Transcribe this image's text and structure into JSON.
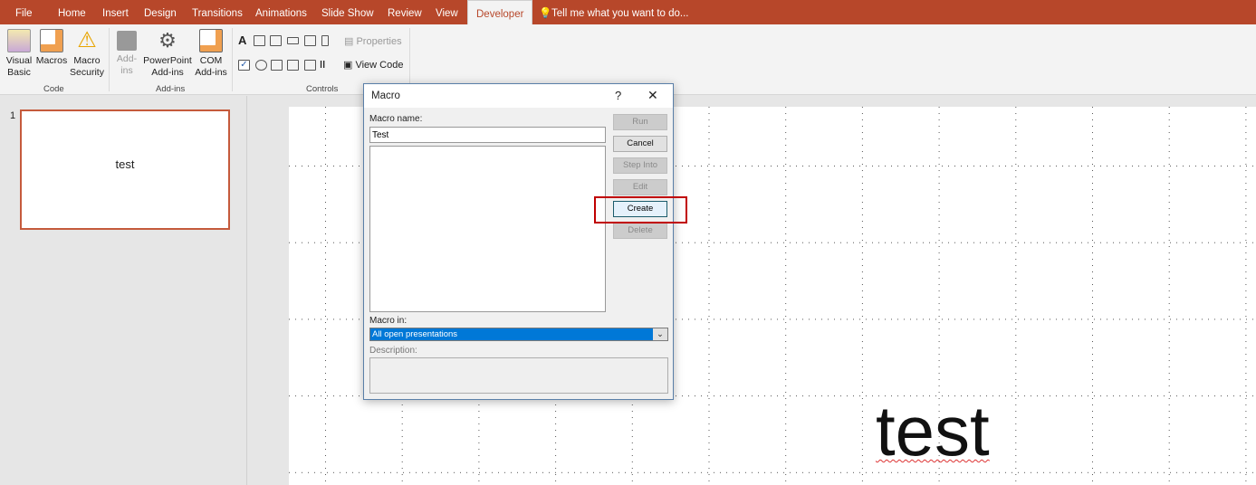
{
  "tabs": [
    "File",
    "Home",
    "Insert",
    "Design",
    "Transitions",
    "Animations",
    "Slide Show",
    "Review",
    "View",
    "Developer"
  ],
  "tell_me": "Tell me what you want to do...",
  "ribbon": {
    "visual_basic": [
      "Visual",
      "Basic"
    ],
    "macros": "Macros",
    "macro_security": [
      "Macro",
      "Security"
    ],
    "addins": [
      "Add-",
      "ins"
    ],
    "ppt_addins": [
      "PowerPoint",
      "Add-ins"
    ],
    "com_addins": [
      "COM",
      "Add-ins"
    ],
    "properties": "Properties",
    "view_code": "View Code",
    "control_a": "A",
    "groups": {
      "code": "Code",
      "addins": "Add-ins",
      "controls": "Controls"
    }
  },
  "slides": {
    "number": "1",
    "thumb_text": "test"
  },
  "slide_text": "test",
  "dialog": {
    "title": "Macro",
    "help": "?",
    "close": "✕",
    "macro_name_label": "Macro name:",
    "macro_name_value": "Test",
    "buttons": {
      "run": "Run",
      "cancel": "Cancel",
      "step_into": "Step Into",
      "edit": "Edit",
      "create": "Create",
      "delete": "Delete"
    },
    "macro_in_label": "Macro in:",
    "macro_in_value": "All open presentations",
    "description_label": "Description:"
  },
  "colors": {
    "accent": "#b7472a",
    "highlight": "#c00000",
    "selection": "#0078d7"
  }
}
